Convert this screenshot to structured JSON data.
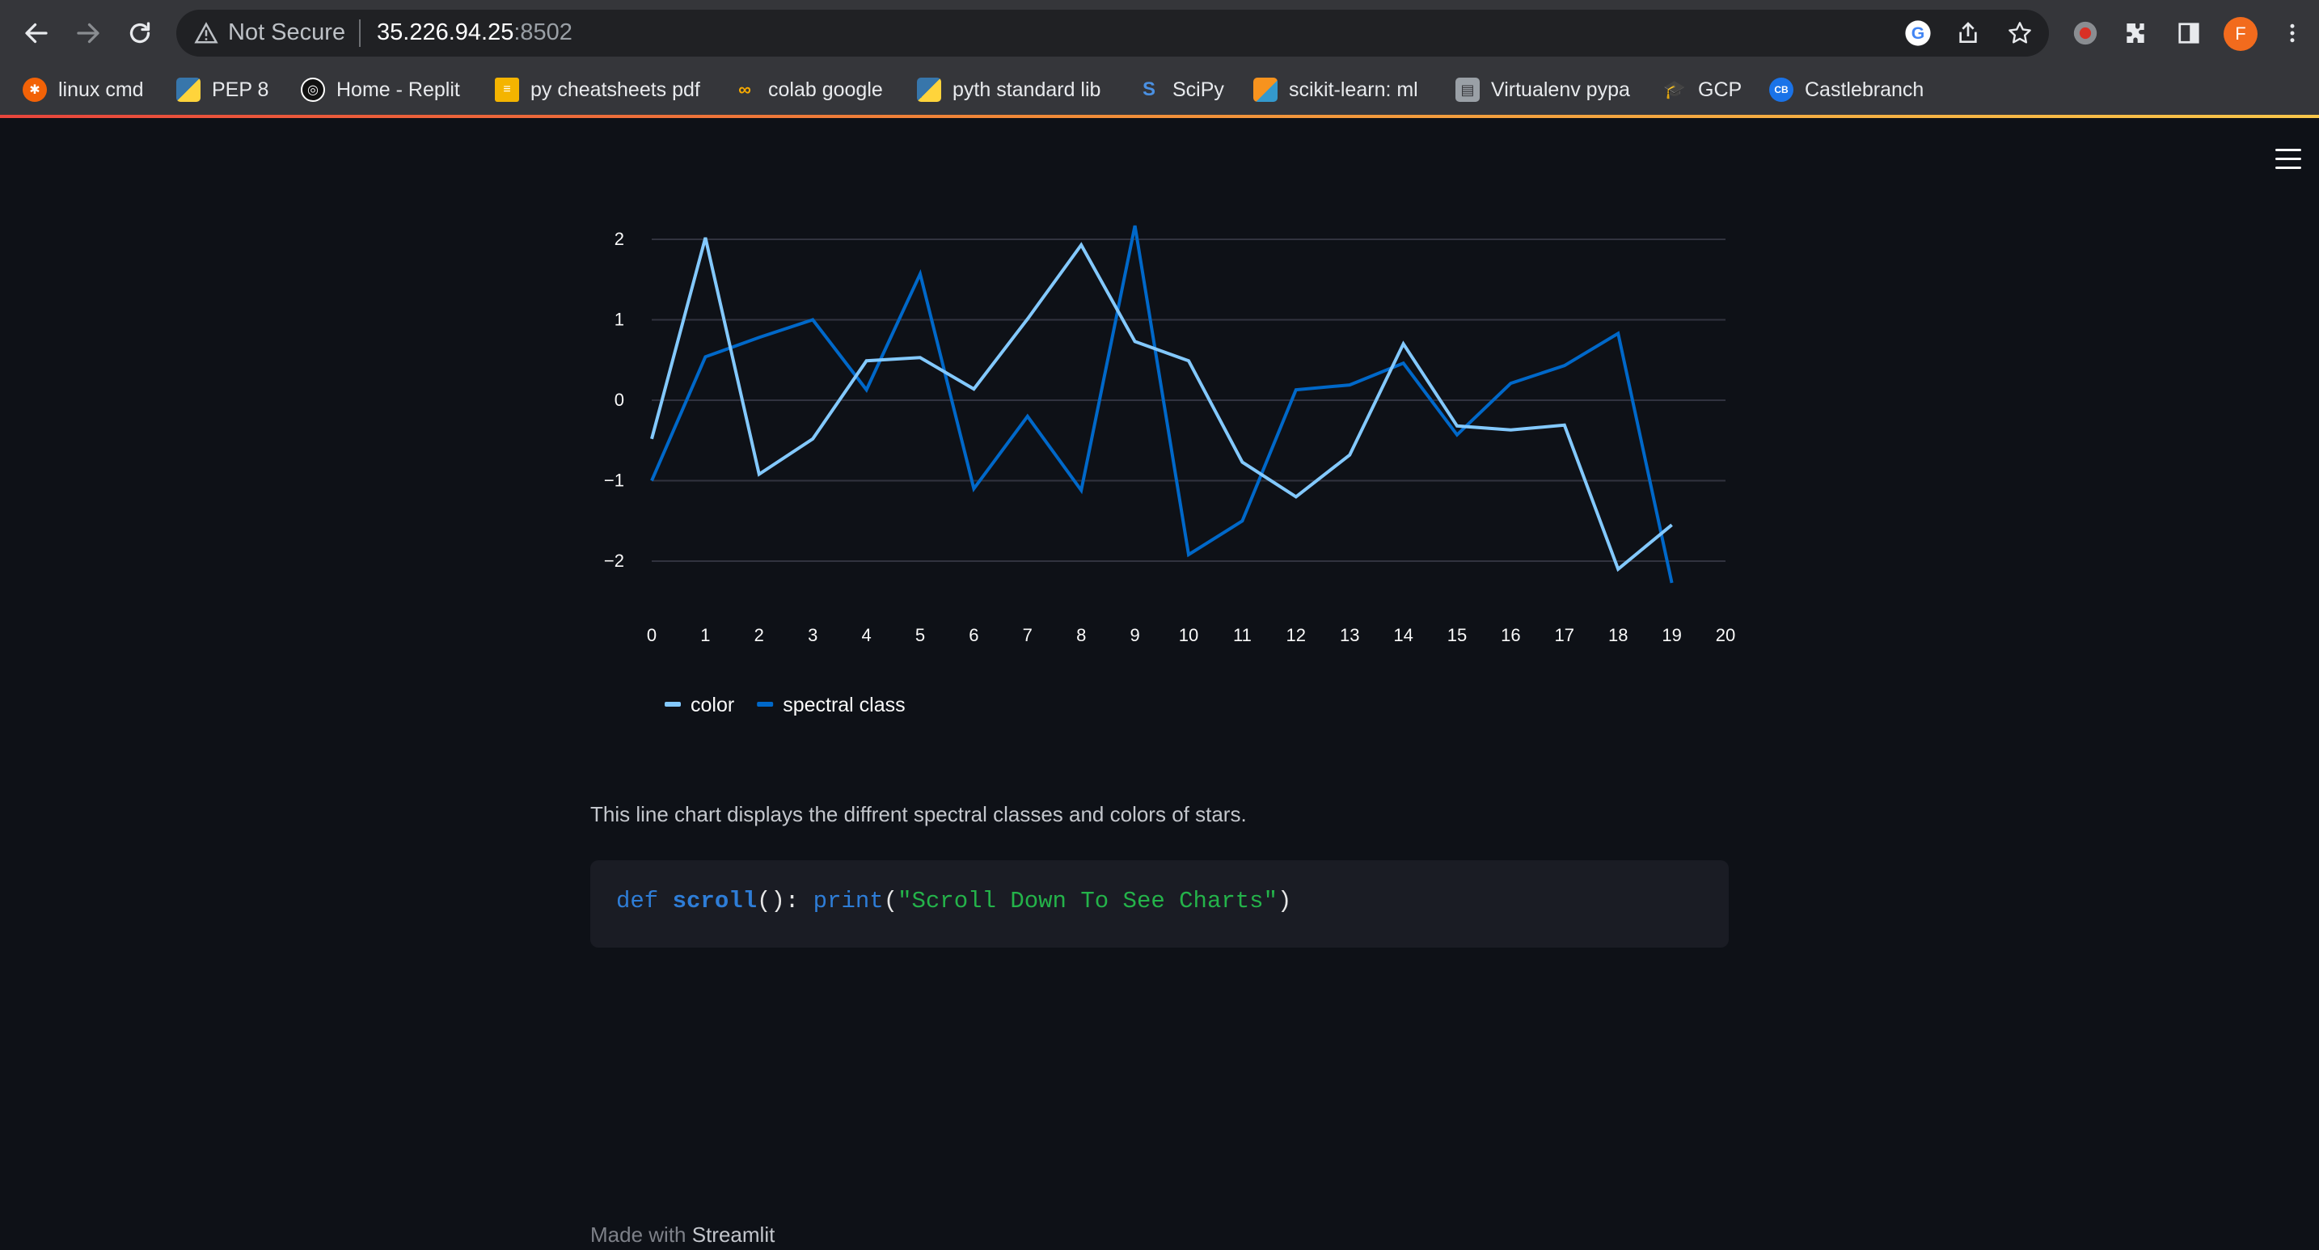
{
  "browser": {
    "security_label": "Not Secure",
    "url_host": "35.226.94.25",
    "url_port": ":8502",
    "profile_initial": "F",
    "bookmarks": [
      {
        "label": "linux cmd",
        "icon": "replit-style-icon",
        "color": "#f26207"
      },
      {
        "label": "PEP 8",
        "icon": "python-icon",
        "color": "#3776ab"
      },
      {
        "label": "Home - Replit",
        "icon": "replit-icon",
        "color": "#111111"
      },
      {
        "label": "py cheatsheets pdf",
        "icon": "document-icon",
        "color": "#f4b400"
      },
      {
        "label": "colab google",
        "icon": "colab-icon",
        "color": "#f9ab00"
      },
      {
        "label": "pyth standard lib",
        "icon": "python-icon",
        "color": "#3776ab"
      },
      {
        "label": "SciPy",
        "icon": "scipy-icon",
        "color": "#0054a6"
      },
      {
        "label": "scikit-learn: ml",
        "icon": "sklearn-icon",
        "color": "#f7931e"
      },
      {
        "label": "Virtualenv pypa",
        "icon": "virtualenv-icon",
        "color": "#6b7280"
      },
      {
        "label": "GCP",
        "icon": "graduation-cap-icon",
        "color": "#4285f4"
      },
      {
        "label": "Castlebranch",
        "icon": "cb-icon",
        "color": "#1a73e8"
      }
    ]
  },
  "chart_data": {
    "type": "line",
    "x": [
      0,
      1,
      2,
      3,
      4,
      5,
      6,
      7,
      8,
      9,
      10,
      11,
      12,
      13,
      14,
      15,
      16,
      17,
      18,
      19
    ],
    "xlim": [
      0,
      20
    ],
    "ylim": [
      -2.5,
      2.3
    ],
    "xticks": [
      0,
      1,
      2,
      3,
      4,
      5,
      6,
      7,
      8,
      9,
      10,
      11,
      12,
      13,
      14,
      15,
      16,
      17,
      18,
      19,
      20
    ],
    "yticks": [
      2,
      1,
      0,
      -1,
      -2
    ],
    "ytick_labels": [
      "2",
      "1",
      "0",
      "−1",
      "−2"
    ],
    "grid": "horizontal",
    "legend_position": "bottom",
    "series": [
      {
        "name": "color",
        "color": "#83c9ff",
        "values": [
          -0.48,
          2.02,
          -0.92,
          -0.48,
          0.49,
          0.53,
          0.14,
          1.01,
          1.93,
          0.73,
          0.49,
          -0.77,
          -1.2,
          -0.68,
          0.7,
          -0.32,
          -0.37,
          -0.31,
          -2.1,
          -1.55
        ]
      },
      {
        "name": "spectral class",
        "color": "#0068c9",
        "values": [
          -1.0,
          0.54,
          0.78,
          1.0,
          0.13,
          1.57,
          -1.1,
          -0.2,
          -1.12,
          2.17,
          -1.92,
          -1.5,
          0.13,
          0.19,
          0.46,
          -0.43,
          0.21,
          0.43,
          0.83,
          -2.27
        ]
      }
    ]
  },
  "caption": "This line chart displays the diffrent spectral classes and colors of stars.",
  "code": {
    "kw": "def",
    "fn": "scroll",
    "parens": "(): ",
    "builtin": "print",
    "open": "(",
    "str": "\"Scroll Down To See Charts\"",
    "close": ")"
  },
  "footer": {
    "prefix": "Made with ",
    "brand": "Streamlit"
  }
}
